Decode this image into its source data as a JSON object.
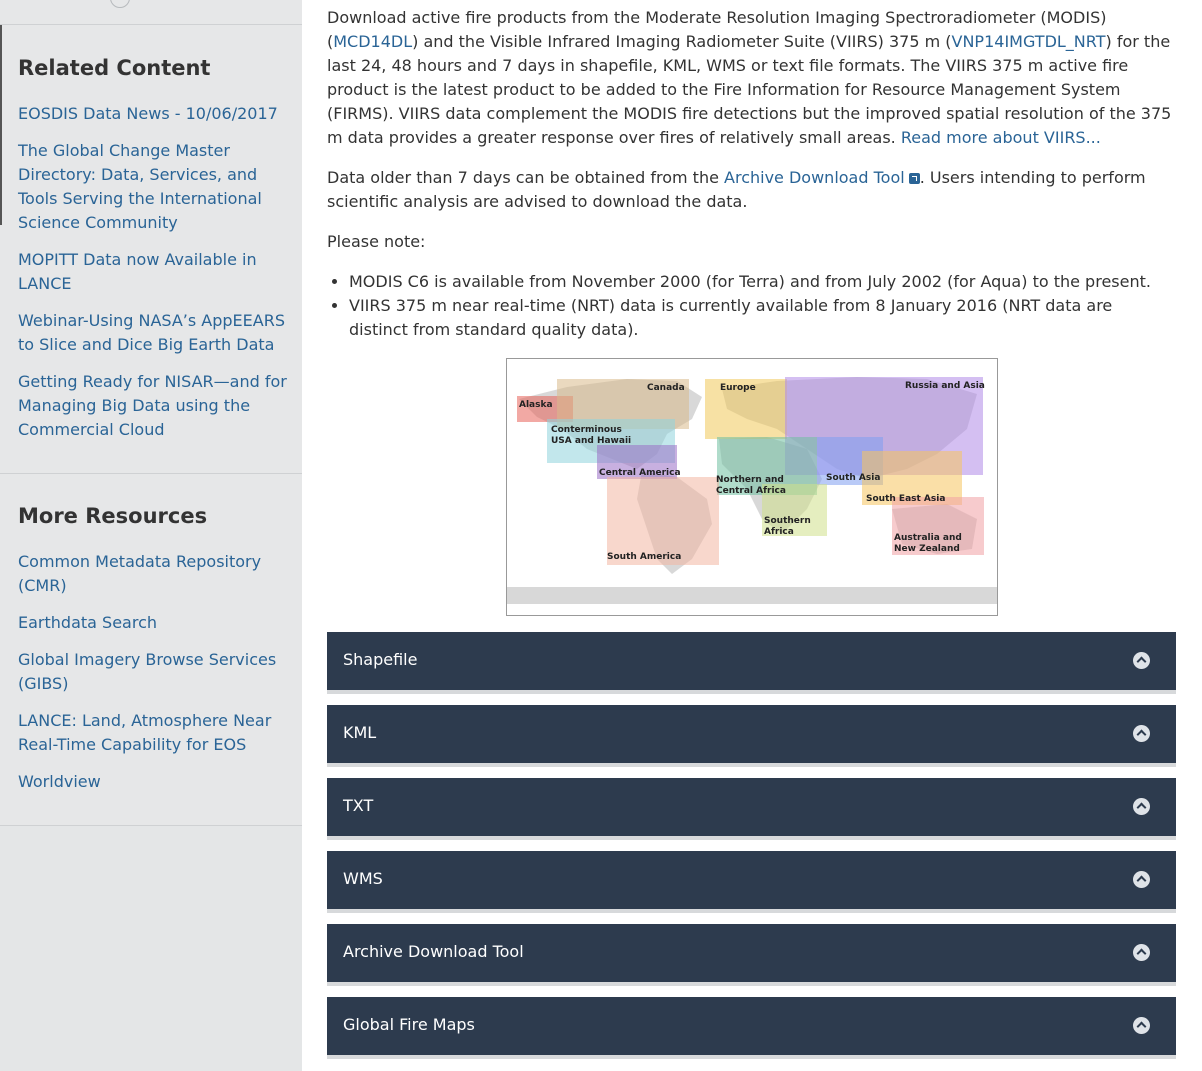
{
  "sidebar": {
    "related": {
      "heading": "Related Content",
      "items": [
        "EOSDIS Data News - 10/06/2017",
        "The Global Change Master Directory: Data, Services, and Tools Serving the International Science Community",
        "MOPITT Data now Available in LANCE",
        "Webinar-Using NASA’s AppEEARS to Slice and Dice Big Earth Data",
        "Getting Ready for NISAR—and for Managing Big Data using the Commercial Cloud"
      ]
    },
    "resources": {
      "heading": "More Resources",
      "items": [
        "Common Metadata Repository (CMR)",
        "Earthdata Search",
        "Global Imagery Browse Services (GIBS)",
        "LANCE: Land, Atmosphere Near Real-Time Capability for EOS",
        "Worldview"
      ]
    }
  },
  "main": {
    "intro": {
      "t1": "Download active fire products from the Moderate Resolution Imaging Spectroradiometer (MODIS) (",
      "link1": "MCD14DL",
      "t2": ") and the Visible Infrared Imaging Radiometer Suite (VIIRS) 375 m (",
      "link2": "VNP14IMGTDL_NRT",
      "t3": ") for the last 24, 48 hours and 7 days in shapefile, KML, WMS or text file formats. The VIIRS 375 m active fire product is the latest product to be added to the Fire Information for Resource Management System (FIRMS). VIIRS data complement the MODIS fire detections but the improved spatial resolution of the 375 m data provides a greater response over fires of relatively small areas. ",
      "link3": "Read more about VIIRS..."
    },
    "archive": {
      "t1": "Data older than 7 days can be obtained from the ",
      "link": "Archive Download Tool",
      "t2": ". Users intending to perform scientific analysis are advised to download the data."
    },
    "note_heading": "Please note:",
    "notes": [
      "MODIS C6 is available from November 2000 (for Terra) and from July 2002 (for Aqua) to the present.",
      "VIIRS 375 m near real-time (NRT) data is currently available from 8 January 2016 (NRT data are distinct from standard quality data)."
    ],
    "map_regions": [
      {
        "label": "Alaska",
        "color": "#e8625a"
      },
      {
        "label": "Canada",
        "color": "#d9b98a"
      },
      {
        "label": "Europe",
        "color": "#f0c95a"
      },
      {
        "label": "Russia and Asia",
        "color": "#b08be8"
      },
      {
        "label": "Conterminous USA and Hawaii",
        "color": "#8fd3dc"
      },
      {
        "label": "Central America",
        "color": "#9a6fc7"
      },
      {
        "label": "Northern and Central Africa",
        "color": "#6fbfa0"
      },
      {
        "label": "South Asia",
        "color": "#7f9ef0"
      },
      {
        "label": "South East Asia",
        "color": "#f5c55e"
      },
      {
        "label": "Southern Africa",
        "color": "#cfe08a"
      },
      {
        "label": "Australia and New Zealand",
        "color": "#f0a0a4"
      },
      {
        "label": "South America",
        "color": "#f2b7a3"
      }
    ],
    "accordions": [
      "Shapefile",
      "KML",
      "TXT",
      "WMS",
      "Archive Download Tool",
      "Global Fire Maps"
    ]
  }
}
